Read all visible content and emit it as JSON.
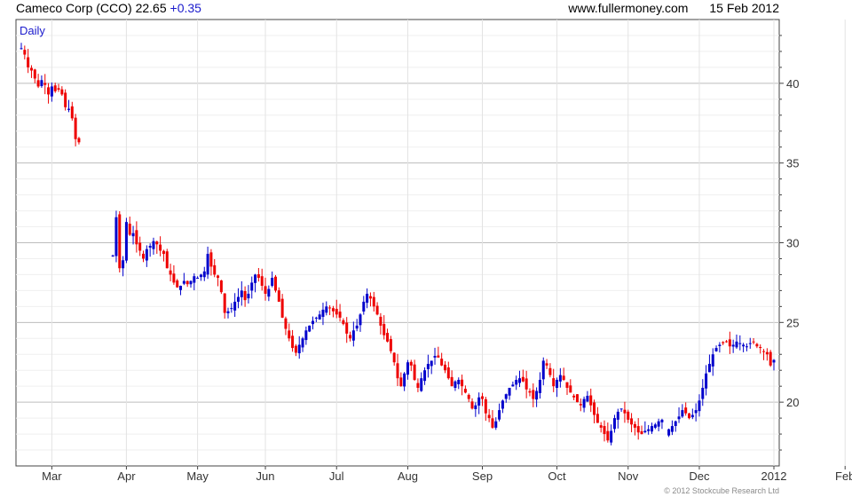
{
  "header": {
    "title": "Cameco Corp (CCO)",
    "price": "22.65",
    "change": "+0.35",
    "site": "www.fullermoney.com",
    "date": "15 Feb 2012"
  },
  "colors": {
    "up": "#0000cc",
    "down": "#ee0000",
    "grid": "#dddddd",
    "axis": "#444444",
    "label_blue": "#1a1acc"
  },
  "footer": "© 2012 Stockcube Research Ltd",
  "chart_data": {
    "type": "candlestick",
    "title": "Daily",
    "ylim": [
      16,
      44
    ],
    "y_ticks": [
      20,
      25,
      30,
      35,
      40
    ],
    "x_ticks": [
      "Mar",
      "Apr",
      "May",
      "Jun",
      "Jul",
      "Aug",
      "Sep",
      "Oct",
      "Nov",
      "Dec",
      "2012",
      "Feb"
    ],
    "x_tick_index": [
      9,
      31,
      52,
      72,
      93,
      114,
      136,
      158,
      179,
      200,
      222,
      243
    ],
    "grid": true,
    "y_axis_side": "right",
    "series": [
      {
        "name": "CCO",
        "close": [
          42.2,
          41.8,
          41.0,
          40.8,
          40.3,
          39.8,
          40.2,
          39.9,
          39.3,
          39.8,
          39.5,
          39.6,
          39.3,
          38.5,
          38.4,
          37.8,
          36.5,
          36.3,
          null,
          null,
          null,
          null,
          null,
          null,
          null,
          null,
          null,
          null,
          null,
          null,
          null,
          null,
          null,
          null,
          null,
          null,
          null,
          null,
          null,
          null,
          null,
          null,
          null,
          null,
          null,
          null,
          null,
          null,
          null,
          null,
          null,
          null,
          null,
          null,
          null,
          null,
          null,
          null,
          null,
          null,
          null,
          null,
          null,
          null,
          null,
          null,
          null,
          null,
          null,
          null,
          null,
          null,
          null,
          null,
          null,
          null,
          null,
          null,
          null,
          null,
          null,
          null,
          null,
          null,
          null,
          null,
          null,
          null,
          null,
          null,
          null,
          null,
          null,
          null,
          null,
          null,
          null,
          null,
          null,
          null,
          null,
          null,
          null,
          null,
          null,
          null,
          null,
          null,
          null,
          null,
          null,
          null,
          null,
          null,
          null,
          null,
          null,
          null,
          null,
          null,
          null,
          null,
          null,
          null,
          null,
          null,
          null,
          null,
          null,
          null,
          null,
          null,
          null,
          null,
          null,
          null,
          null,
          null,
          null,
          null,
          null,
          null,
          null,
          null,
          null,
          null,
          null,
          null,
          null,
          null,
          null,
          null,
          null,
          null,
          null,
          null,
          null,
          null,
          null,
          null,
          null,
          null,
          null,
          null,
          null,
          null,
          null,
          null,
          null,
          null,
          null,
          null,
          null,
          null,
          null,
          null,
          null,
          null,
          null,
          null,
          null,
          null,
          null,
          null,
          null,
          null,
          null,
          null,
          null,
          null,
          null,
          null,
          null,
          null,
          null,
          null,
          null,
          null,
          null,
          null,
          null,
          null,
          null,
          null,
          null,
          null,
          null,
          null,
          null,
          null,
          null,
          null,
          null,
          null,
          null,
          null,
          null,
          null,
          null,
          null,
          null,
          null,
          null,
          null,
          null,
          null,
          null,
          null,
          null,
          null,
          null,
          null,
          null,
          null,
          null,
          null,
          null,
          null,
          null,
          null,
          null,
          null,
          null,
          null,
          null,
          null,
          null,
          null
        ],
        "closes_after_gap": [
          29.2,
          31.6,
          28.4,
          28.9,
          31.3,
          30.5,
          30.6,
          29.9,
          29.5,
          29.0,
          29.6,
          29.8,
          30.1,
          29.9,
          29.5,
          29.3,
          28.4,
          28.0,
          27.5,
          27.2,
          27.3,
          27.6,
          27.4,
          27.6,
          27.9,
          27.8,
          28.0,
          28.2,
          29.3,
          28.5,
          28.0,
          27.8,
          26.9,
          25.6,
          25.7,
          25.9,
          26.3,
          26.6,
          27.0,
          26.4,
          26.8,
          27.5,
          28.0,
          27.8,
          27.3,
          26.8,
          27.1,
          27.8,
          27.0,
          26.3,
          25.3,
          24.6,
          24.0,
          23.4,
          23.1,
          23.6,
          24.0,
          24.5,
          24.8,
          25.1,
          25.3,
          25.5,
          25.8,
          26.0,
          25.9,
          25.7,
          25.5,
          25.3,
          24.9,
          24.3,
          24.0,
          24.5,
          24.8,
          25.5,
          26.3,
          26.8,
          26.5,
          26.0,
          25.5,
          24.8,
          24.2,
          23.8,
          23.2,
          22.5,
          21.5,
          21.0,
          21.8,
          22.5,
          22.3,
          21.4,
          20.9,
          21.5,
          22.0,
          22.4,
          22.6,
          22.9,
          22.8,
          22.3,
          22.0,
          21.5,
          21.0,
          21.3,
          21.4,
          21.0,
          20.6,
          20.2,
          19.6,
          19.8,
          20.3,
          20.2,
          19.3,
          19.0,
          18.4,
          18.8,
          19.5,
          20.1,
          20.5,
          20.9,
          21.1,
          21.4,
          21.5,
          21.3,
          20.8,
          20.6,
          20.2,
          20.7,
          21.4,
          22.6,
          22.3,
          21.7,
          21.0,
          21.4,
          21.7,
          21.4,
          20.9,
          20.6,
          20.3,
          20.0,
          19.8,
          20.2,
          20.4,
          19.8,
          19.2,
          18.7,
          18.4,
          18.0,
          17.6,
          18.2,
          19.0,
          19.4,
          19.6,
          19.3,
          18.9,
          18.6,
          18.4,
          18.1,
          18.0,
          18.2,
          18.3,
          18.5,
          18.6,
          18.8,
          18.9,
          null,
          18.3,
          18.5,
          18.8,
          19.1,
          19.5,
          19.3,
          19.0,
          19.2,
          19.5,
          20.1,
          20.9,
          21.8,
          22.4,
          23.0,
          23.4,
          23.6,
          23.7,
          23.8,
          23.5,
          23.6,
          23.8,
          23.7,
          23.6,
          23.5,
          23.7,
          23.8,
          23.5,
          23.4,
          23.2,
          23.0,
          22.3,
          22.65
        ]
      }
    ]
  }
}
